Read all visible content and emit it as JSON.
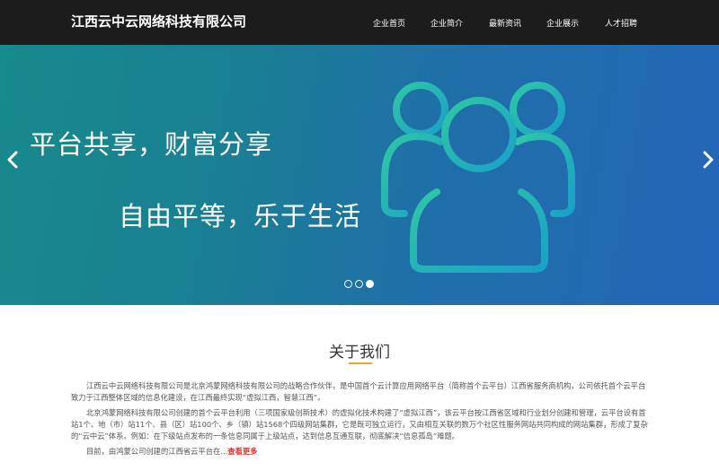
{
  "header": {
    "site_title": "江西云中云网络科技有限公司",
    "nav": [
      {
        "label": "企业首页"
      },
      {
        "label": "企业简介"
      },
      {
        "label": "最新资讯"
      },
      {
        "label": "企业展示"
      },
      {
        "label": "人才招聘"
      }
    ]
  },
  "banner": {
    "slogan_1": "平台共享，财富分享",
    "slogan_2": "自由平等，乐于生活",
    "icon": "group-people-icon",
    "prev_icon": "chevron-left-icon",
    "next_icon": "chevron-right-icon",
    "slide_count": 3,
    "active_slide": 3
  },
  "about": {
    "title": "关于我们",
    "paragraph_1": "江西云中云网络科技有限公司是北京鸿蒙网络科技有限公司的战略合作伙伴，是中国首个云计算应用网络平台（简称首个云平台）江西省服务商机构，公司依托首个云平台致力于江西整体区域的信息化建设，在江西最终实现“虚拟江西，智慧江西”。",
    "paragraph_2": "北京鸿蒙网络科技有限公司创建的首个云平台利用（三项国家级创新技术）的虚拟化技术构建了“虚拟江西”，该云平台按江西省区域和行业划分创建和管理，云平台设有首站1个、地（市）站11个、县（区）站100个、乡（镇）站1568个四级网站集群，它是既可独立运行，又由相互关联的数万个社区性服务网站共同构成的网站集群，形成了复杂的“云中云”体系。例如：在下级站点发布的一条信息同属于上级站点，达到信息互通互联，彻底解决“信息孤岛”难题。",
    "paragraph_3": "目前，由鸿蒙公司创建的江西省云平台在...",
    "read_more": "查看更多"
  },
  "colors": {
    "topbar": "#1c1c1c",
    "banner_start": "#178a8c",
    "banner_end": "#2466b8",
    "accent": "#e5a43c",
    "read_more": "#d9342b"
  }
}
